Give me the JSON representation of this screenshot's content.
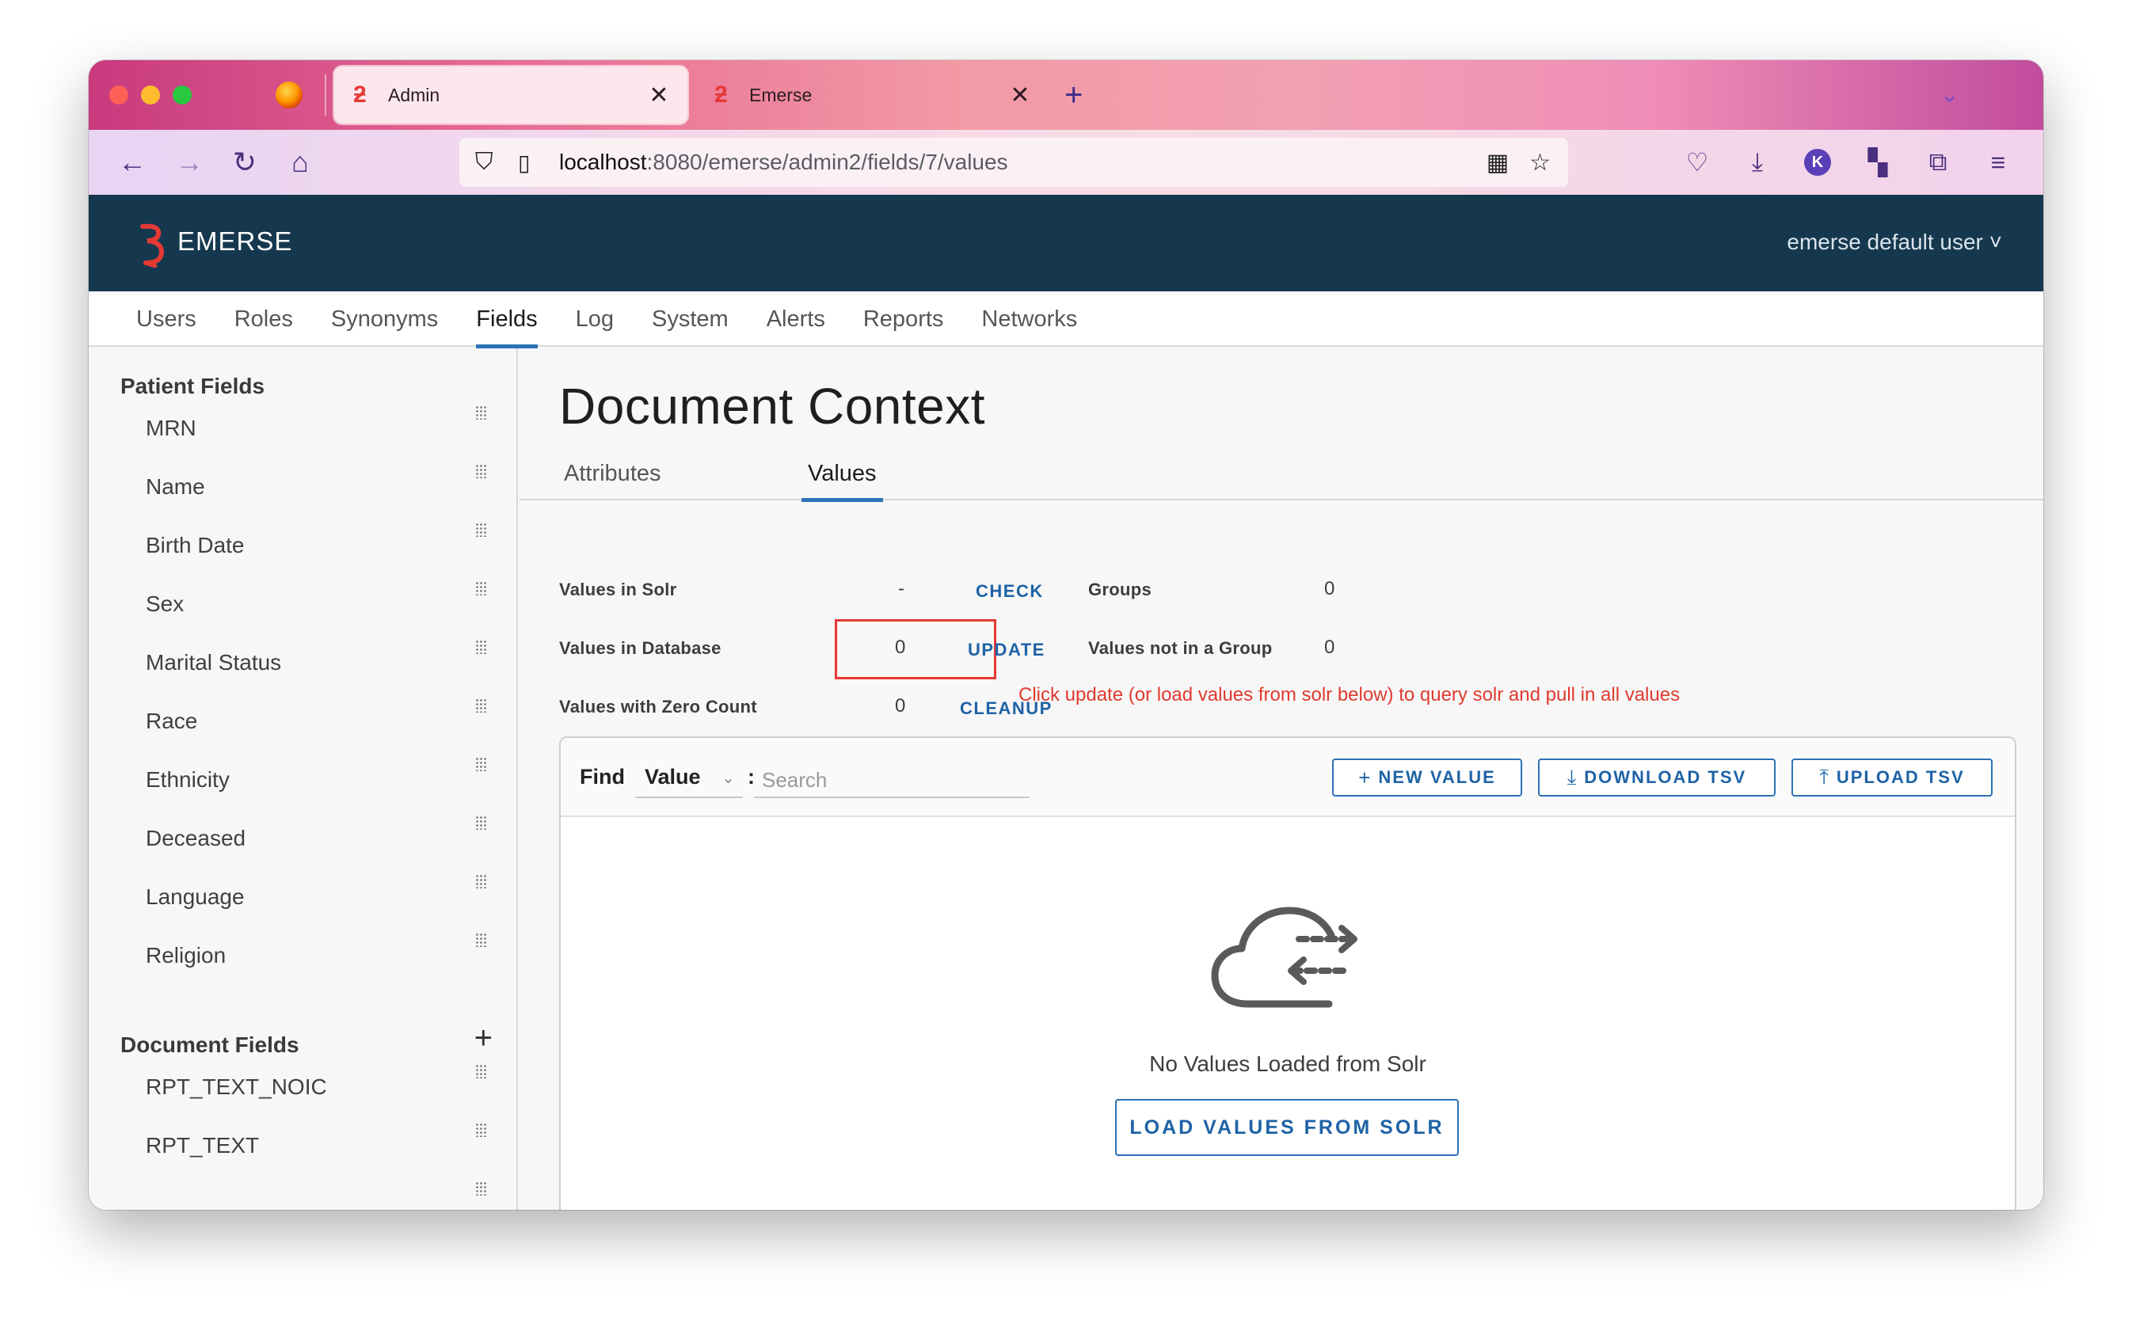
{
  "browser": {
    "tabs": [
      {
        "title": "Admin",
        "active": true
      },
      {
        "title": "Emerse",
        "active": false
      }
    ],
    "url_host": "localhost",
    "url_rest": ":8080/emerse/admin2/fields/7/values",
    "profile_initial": "K"
  },
  "app": {
    "logo_text": "EMERSE",
    "user_menu": "emerse default user ˅",
    "nav": [
      "Users",
      "Roles",
      "Synonyms",
      "Fields",
      "Log",
      "System",
      "Alerts",
      "Reports",
      "Networks"
    ],
    "nav_active": "Fields"
  },
  "sidebar": {
    "patient_section": "Patient Fields",
    "patient_fields": [
      "MRN",
      "Name",
      "Birth Date",
      "Sex",
      "Marital Status",
      "Race",
      "Ethnicity",
      "Deceased",
      "Language",
      "Religion"
    ],
    "document_section": "Document Fields",
    "add_icon": "+",
    "document_fields": [
      "RPT_TEXT_NOIC",
      "RPT_TEXT"
    ]
  },
  "content": {
    "title": "Document Context",
    "tabs": {
      "attributes": "Attributes",
      "values": "Values"
    },
    "stats": {
      "solr_label": "Values in Solr",
      "solr_value": "-",
      "check": "CHECK",
      "db_label": "Values in Database",
      "db_value": "0",
      "update": "UPDATE",
      "zero_label": "Values with Zero Count",
      "zero_value": "0",
      "cleanup": "CLEANUP",
      "groups_label": "Groups",
      "groups_value": "0",
      "nogroup_label": "Values not in a Group",
      "nogroup_value": "0"
    },
    "hint": "Click update (or load values from solr below) to query solr and pull in all values",
    "find": {
      "label": "Find",
      "field": "Value",
      "colon": ":",
      "placeholder": "Search"
    },
    "buttons": {
      "new_value": "NEW VALUE",
      "download_tsv": "DOWNLOAD TSV",
      "upload_tsv": "UPLOAD TSV"
    },
    "empty_text": "No Values Loaded from Solr",
    "load_button": "LOAD VALUES FROM SOLR"
  },
  "colors": {
    "header_bg": "#15384f",
    "accent": "#2c71b5",
    "highlight": "#e53935"
  }
}
